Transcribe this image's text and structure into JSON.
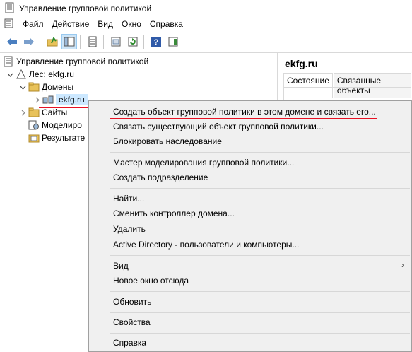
{
  "window": {
    "title": "Управление групповой политикой"
  },
  "menu": [
    "Файл",
    "Действие",
    "Вид",
    "Окно",
    "Справка"
  ],
  "toolbar": {
    "buttons": [
      "back-arrow-icon",
      "forward-arrow-icon",
      "up-folder-icon",
      "show-hide-tree-icon",
      "properties-icon",
      "export-list-icon",
      "refresh-icon",
      "help-icon",
      "action-pane-icon"
    ]
  },
  "tree": {
    "root": "Управление групповой политикой",
    "forest": "Лес: ekfg.ru",
    "domains": "Домены",
    "domain": "ekfg.ru",
    "sites": "Сайты",
    "modeling": "Моделиро",
    "results": "Результате"
  },
  "right_pane": {
    "title": "ekfg.ru",
    "tabs": [
      "Состояние",
      "Связанные объекты"
    ]
  },
  "context_menu": {
    "groups": [
      [
        "Создать объект групповой политики в этом домене и связать его...",
        "Связать существующий объект групповой политики...",
        "Блокировать наследование"
      ],
      [
        "Мастер моделирования групповой политики...",
        "Создать подразделение"
      ],
      [
        "Найти...",
        "Сменить контроллер домена...",
        "Удалить",
        "Active Directory - пользователи и компьютеры..."
      ],
      [
        "Вид",
        "Новое окно отсюда"
      ],
      [
        "Обновить"
      ],
      [
        "Свойства"
      ],
      [
        "Справка"
      ]
    ],
    "submenu_arrow": "›"
  },
  "colors": {
    "highlight_line": "#e81123",
    "selection": "#cce8ff",
    "menu_bg": "#f0f0f0"
  }
}
